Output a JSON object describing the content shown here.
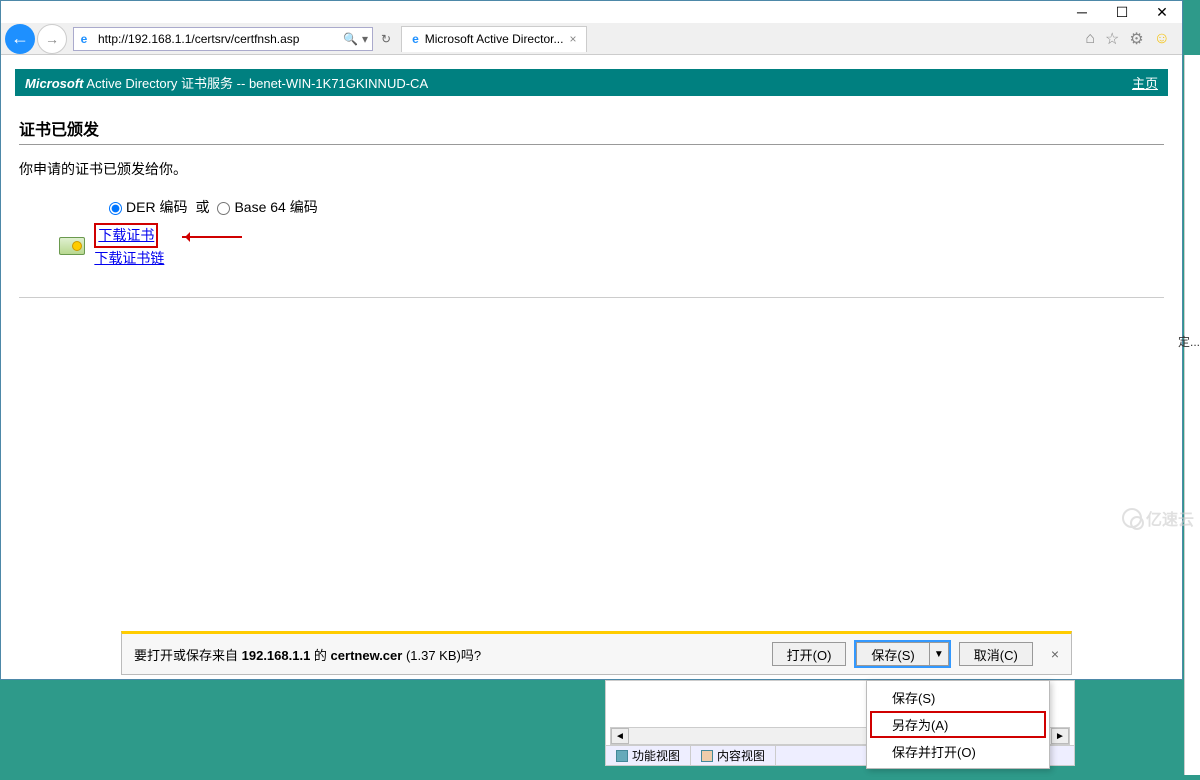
{
  "window": {
    "url": "http://192.168.1.1/certsrv/certfnsh.asp",
    "tab_title": "Microsoft Active Director..."
  },
  "header": {
    "brand": "Microsoft",
    "service": "Active Directory 证书服务",
    "sep": "  --  ",
    "ca_name": "benet-WIN-1K71GKINNUD-CA",
    "home_link": "主页"
  },
  "page": {
    "title": "证书已颁发",
    "message": "你申请的证书已颁发给你。",
    "enc_der": "DER 编码",
    "enc_or": "或",
    "enc_b64": "Base 64 编码",
    "link_cert": "下载证书",
    "link_chain": "下载证书链"
  },
  "download_bar": {
    "prefix": "要打开或保存来自 ",
    "host": "192.168.1.1",
    "mid": " 的 ",
    "file": "certnew.cer",
    "size": " (1.37 KB)",
    "suffix": "吗?",
    "open": "打开(O)",
    "save": "保存(S)",
    "cancel": "取消(C)"
  },
  "save_menu": {
    "save": "保存(S)",
    "save_as": "另存为(A)",
    "save_open": "保存并打开(O)"
  },
  "bottom_tabs": {
    "features": "功能视图",
    "content": "内容视图"
  },
  "right_panel": {
    "item": "定..."
  },
  "watermark": "亿速云"
}
